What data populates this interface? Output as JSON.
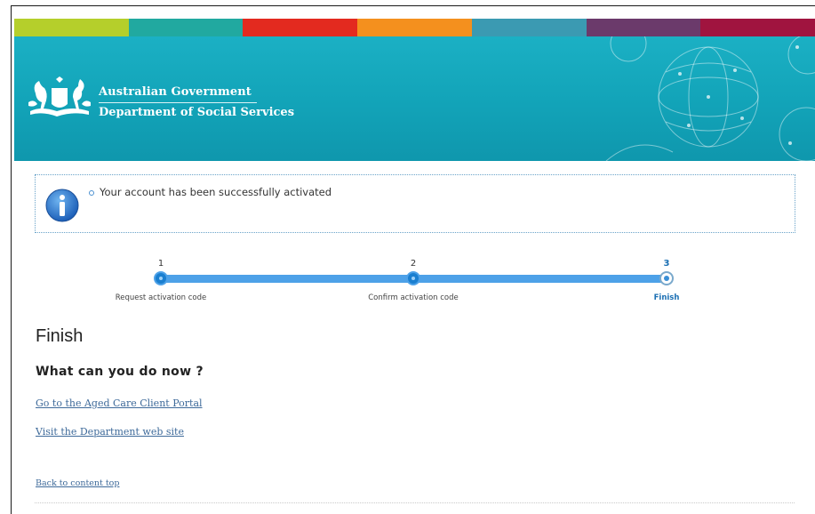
{
  "colors": {
    "stripes": [
      "#b5cf2b",
      "#21a9a0",
      "#e32a1f",
      "#f4901e",
      "#3b9ab2",
      "#6b3a6b",
      "#a0143f"
    ],
    "banner": "#14a6bb",
    "step_active": "#1a7fd0",
    "link": "#3e6a9a"
  },
  "header": {
    "gov_line1": "Australian Government",
    "gov_line2": "Department of Social Services",
    "crest_icon": "coat-of-arms-icon"
  },
  "alert": {
    "icon": "info-icon",
    "message": "Your account has been successfully activated"
  },
  "steps": [
    {
      "number": "1",
      "label": "Request activation code",
      "state": "done"
    },
    {
      "number": "2",
      "label": "Confirm activation code",
      "state": "done"
    },
    {
      "number": "3",
      "label": "Finish",
      "state": "current"
    }
  ],
  "main": {
    "title": "Finish",
    "subtitle": "What can you do now ?",
    "links": [
      "Go to the Aged Care Client Portal",
      "Visit the Department web site"
    ],
    "back_to_top": "Back to content top"
  }
}
